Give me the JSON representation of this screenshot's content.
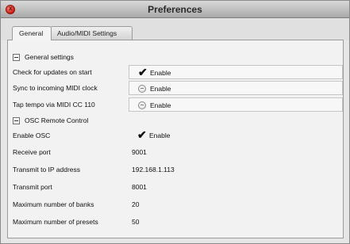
{
  "window": {
    "title": "Preferences",
    "close_icon": "close-icon"
  },
  "tabs": [
    {
      "label": "General",
      "active": true
    },
    {
      "label": "Audio/MIDI Settings",
      "active": false
    }
  ],
  "general_section": {
    "title": "General settings",
    "rows": [
      {
        "label": "Check for updates on start",
        "value": "Enable",
        "checked": true
      },
      {
        "label": "Sync to incoming MIDI clock",
        "value": "Enable",
        "checked": false
      },
      {
        "label": "Tap tempo via MIDI CC 110",
        "value": "Enable",
        "checked": false
      }
    ]
  },
  "osc_section": {
    "title": "OSC Remote Control",
    "enable_row": {
      "label": "Enable OSC",
      "value": "Enable",
      "checked": true
    },
    "rows": [
      {
        "label": "Receive port",
        "value": "9001"
      },
      {
        "label": "Transmit to IP address",
        "value": "192.168.1.113"
      },
      {
        "label": "Transmit port",
        "value": "8001"
      },
      {
        "label": "Maximum number of banks",
        "value": "20"
      },
      {
        "label": "Maximum number of presets",
        "value": "50"
      }
    ]
  }
}
